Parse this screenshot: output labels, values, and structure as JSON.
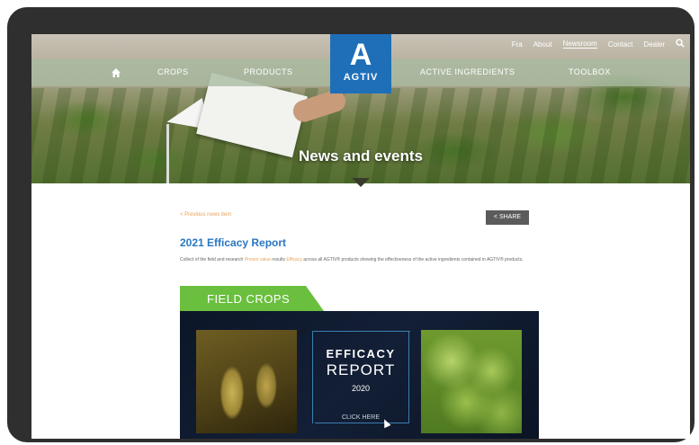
{
  "utility_nav": {
    "items": [
      "Fra",
      "About",
      "Newsroom",
      "Contact",
      "Dealer"
    ],
    "active": "Newsroom",
    "search_icon": "search-icon"
  },
  "logo": {
    "mark": "A",
    "word": "AGTIV"
  },
  "nav": {
    "home_icon": "home-icon",
    "items": [
      "CROPS",
      "PRODUCTS",
      "ACTIVE INGREDIENTS",
      "TOOLBOX"
    ]
  },
  "hero": {
    "title": "News and events"
  },
  "content": {
    "breadcrumb": "< Previous news item",
    "share_label": "< SHARE",
    "article_title": "2021 Efficacy Report",
    "intro_text_1": "Collect of the field and research",
    "intro_link_1": "Proven value",
    "intro_text_2": "results",
    "intro_link_2": "Efficacy",
    "intro_text_3": "across all AGTIV® products showing the effectiveness of the active ingredients contained in AGTIV® products."
  },
  "banner": {
    "tab_label": "FIELD CROPS",
    "efficacy": "EFFICACY",
    "report": "REPORT",
    "year": "2020",
    "cta": "CLICK HERE"
  },
  "colors": {
    "brand_blue": "#1f6fb8",
    "title_blue": "#2877c4",
    "tab_green": "#6abf3f",
    "link_orange": "#e8a25a",
    "banner_dark": "#0c1628"
  }
}
